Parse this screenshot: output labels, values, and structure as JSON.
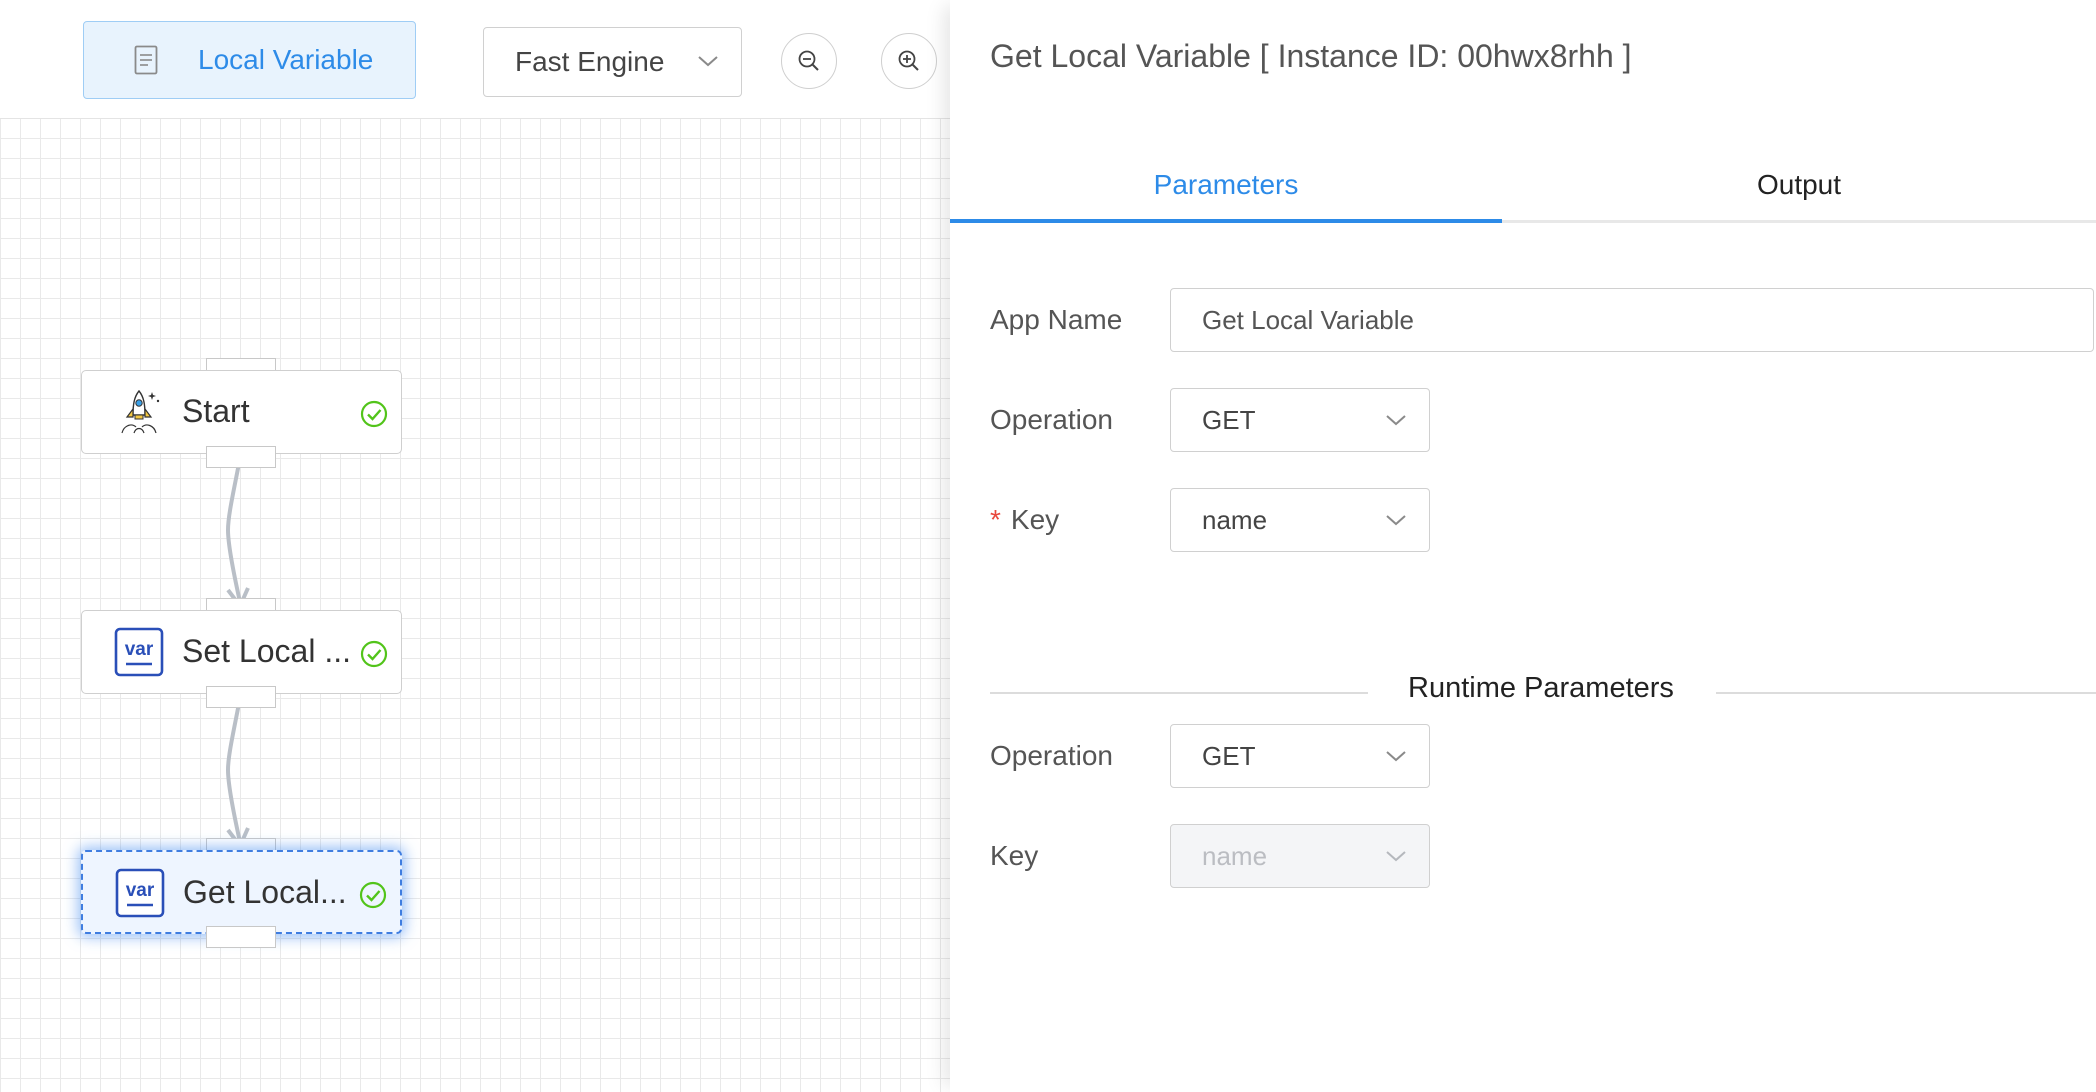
{
  "toolbar": {
    "local_variable_label": "Local Variable",
    "engine_label": "Fast Engine"
  },
  "flow": {
    "nodes": [
      {
        "label": "Start",
        "icon": "rocket-icon",
        "status": "check-circle-icon"
      },
      {
        "label": "Set Local ...",
        "icon": "var-icon",
        "status": "check-circle-icon"
      },
      {
        "label": "Get Local...",
        "icon": "var-icon",
        "status": "check-circle-icon"
      }
    ],
    "var_icon_text": "var"
  },
  "panel": {
    "title": "Get Local Variable [ Instance ID: 00hwx8rhh ]",
    "tabs": [
      "Parameters",
      "Output"
    ],
    "active_tab": "Parameters",
    "fields": {
      "app_name": {
        "label": "App Name",
        "value": "Get Local Variable"
      },
      "operation": {
        "label": "Operation",
        "value": "GET"
      },
      "key": {
        "label": "Key",
        "value": "name",
        "required_mark": "*"
      }
    },
    "runtime_title": "Runtime Parameters",
    "runtime": {
      "operation": {
        "label": "Operation",
        "value": "GET"
      },
      "key": {
        "label": "Key",
        "value": "name",
        "disabled": true
      }
    }
  },
  "colors": {
    "accent": "#2d8be8",
    "success": "#52c41a",
    "var_blue": "#2a4fb8"
  }
}
